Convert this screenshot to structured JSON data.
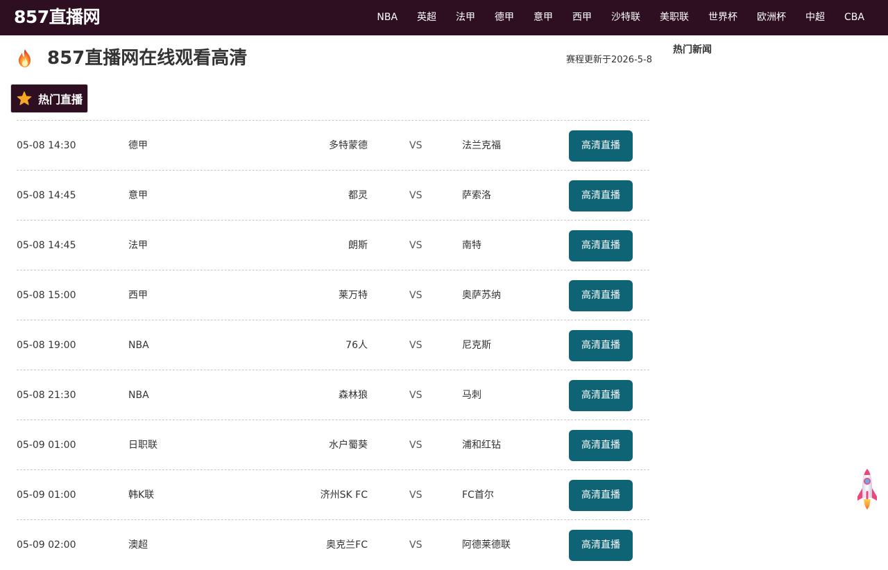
{
  "site": {
    "logo": "857直播网"
  },
  "nav": [
    "NBA",
    "英超",
    "法甲",
    "德甲",
    "意甲",
    "西甲",
    "沙特联",
    "美职联",
    "世界杯",
    "欧洲杯",
    "中超",
    "CBA"
  ],
  "heading": {
    "title": "857直播网在线观看高清",
    "update_note": "赛程更新于2026-5-8"
  },
  "hot_tab": {
    "label": "热门直播"
  },
  "matches": [
    {
      "time": "05-08 14:30",
      "league": "德甲",
      "home": "多特蒙德",
      "vs": "VS",
      "away": "法兰克福",
      "button": "高清直播"
    },
    {
      "time": "05-08 14:45",
      "league": "意甲",
      "home": "都灵",
      "vs": "VS",
      "away": "萨索洛",
      "button": "高清直播"
    },
    {
      "time": "05-08 14:45",
      "league": "法甲",
      "home": "朗斯",
      "vs": "VS",
      "away": "南特",
      "button": "高清直播"
    },
    {
      "time": "05-08 15:00",
      "league": "西甲",
      "home": "莱万特",
      "vs": "VS",
      "away": "奥萨苏纳",
      "button": "高清直播"
    },
    {
      "time": "05-08 19:00",
      "league": "NBA",
      "home": "76人",
      "vs": "VS",
      "away": "尼克斯",
      "button": "高清直播"
    },
    {
      "time": "05-08 21:30",
      "league": "NBA",
      "home": "森林狼",
      "vs": "VS",
      "away": "马刺",
      "button": "高清直播"
    },
    {
      "time": "05-09 01:00",
      "league": "日职联",
      "home": "水户蜀葵",
      "vs": "VS",
      "away": "浦和红钻",
      "button": "高清直播"
    },
    {
      "time": "05-09 01:00",
      "league": "韩K联",
      "home": "济州SK FC",
      "vs": "VS",
      "away": "FC首尔",
      "button": "高清直播"
    },
    {
      "time": "05-09 02:00",
      "league": "澳超",
      "home": "奥克兰FC",
      "vs": "VS",
      "away": "阿德莱德联",
      "button": "高清直播"
    }
  ],
  "sidebar": {
    "title": "热门新闻"
  },
  "colors": {
    "header_bg": "#2e0f22",
    "button_bg": "#0e6375",
    "accent_star": "#f5a623"
  },
  "icons": {
    "heading_icon": "fire-icon",
    "tab_icon": "star-icon",
    "back_to_top": "rocket-icon"
  }
}
